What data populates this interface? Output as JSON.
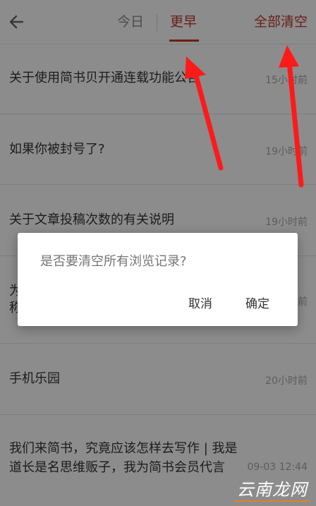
{
  "header": {
    "tab_today": "今日",
    "tab_earlier": "更早",
    "clear_all": "全部清空"
  },
  "list": [
    {
      "title": "关于使用简书贝开通连载功能公告",
      "time": "15小时前"
    },
    {
      "title": "如果你被封号了?",
      "time": "19小时前"
    },
    {
      "title": "关于文章投稿次数的有关说明",
      "time": "19小时前"
    },
    {
      "title": "为",
      "title2": "称",
      "time": "19小时前"
    },
    {
      "title": "手机乐园",
      "time": "20小时前"
    },
    {
      "title": "我们来简书，究竟应该怎样去写作 | 我是道长是名思维贩子，我为简书会员代言",
      "time": "09-03 12:44"
    }
  ],
  "dialog": {
    "message": "是否要清空所有浏览记录?",
    "cancel": "取消",
    "confirm": "确定"
  },
  "watermark": "云南龙网",
  "colors": {
    "accent": "#c0392b",
    "arrow": "#ff1a1a"
  }
}
